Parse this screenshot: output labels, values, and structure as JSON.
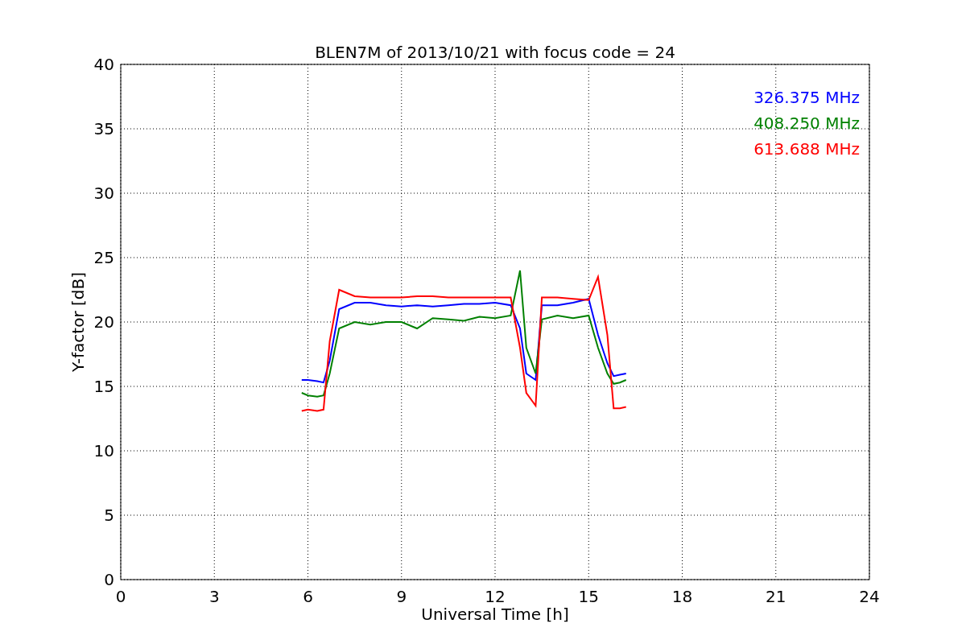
{
  "chart_data": {
    "type": "line",
    "title": "BLEN7M of 2013/10/21 with focus code = 24",
    "xlabel": "Universal Time [h]",
    "ylabel": "Y-factor [dB]",
    "x": [
      5.8,
      6.0,
      6.3,
      6.5,
      6.7,
      7.0,
      7.5,
      8,
      8.5,
      9,
      9.5,
      10,
      10.5,
      11,
      11.5,
      12,
      12.5,
      12.8,
      13,
      13.3,
      13.5,
      14,
      14.5,
      15,
      15.3,
      15.6,
      15.8,
      16,
      16.2
    ],
    "series": [
      {
        "name": "326.375 MHz",
        "color": "#0000ff",
        "values": [
          15.5,
          15.5,
          15.4,
          15.3,
          17,
          21,
          21.5,
          21.5,
          21.3,
          21.2,
          21.3,
          21.2,
          21.3,
          21.4,
          21.4,
          21.5,
          21.3,
          19.5,
          16,
          15.5,
          21.3,
          21.3,
          21.5,
          21.8,
          19,
          16.8,
          15.8,
          15.9,
          16.0
        ]
      },
      {
        "name": "408.250 MHz",
        "color": "#008000",
        "values": [
          14.5,
          14.3,
          14.2,
          14.3,
          16,
          19.5,
          20,
          19.8,
          20,
          20,
          19.5,
          20.3,
          20.2,
          20.1,
          20.4,
          20.3,
          20.5,
          24,
          18,
          16,
          20.2,
          20.5,
          20.3,
          20.5,
          18,
          16,
          15.2,
          15.3,
          15.5
        ]
      },
      {
        "name": "613.688 MHz",
        "color": "#ff0000",
        "values": [
          13.1,
          13.2,
          13.1,
          13.2,
          18.5,
          22.5,
          22,
          21.9,
          21.9,
          21.9,
          22,
          22,
          21.9,
          21.9,
          21.9,
          21.9,
          21.9,
          18,
          14.5,
          13.5,
          21.9,
          21.9,
          21.8,
          21.7,
          23.5,
          19,
          13.3,
          13.3,
          13.4
        ]
      }
    ],
    "xlim": [
      0,
      24
    ],
    "ylim": [
      0,
      40
    ],
    "xticks": [
      0,
      3,
      6,
      9,
      12,
      15,
      18,
      21,
      24
    ],
    "yticks": [
      0,
      5,
      10,
      15,
      20,
      25,
      30,
      35,
      40
    ],
    "grid": true
  }
}
